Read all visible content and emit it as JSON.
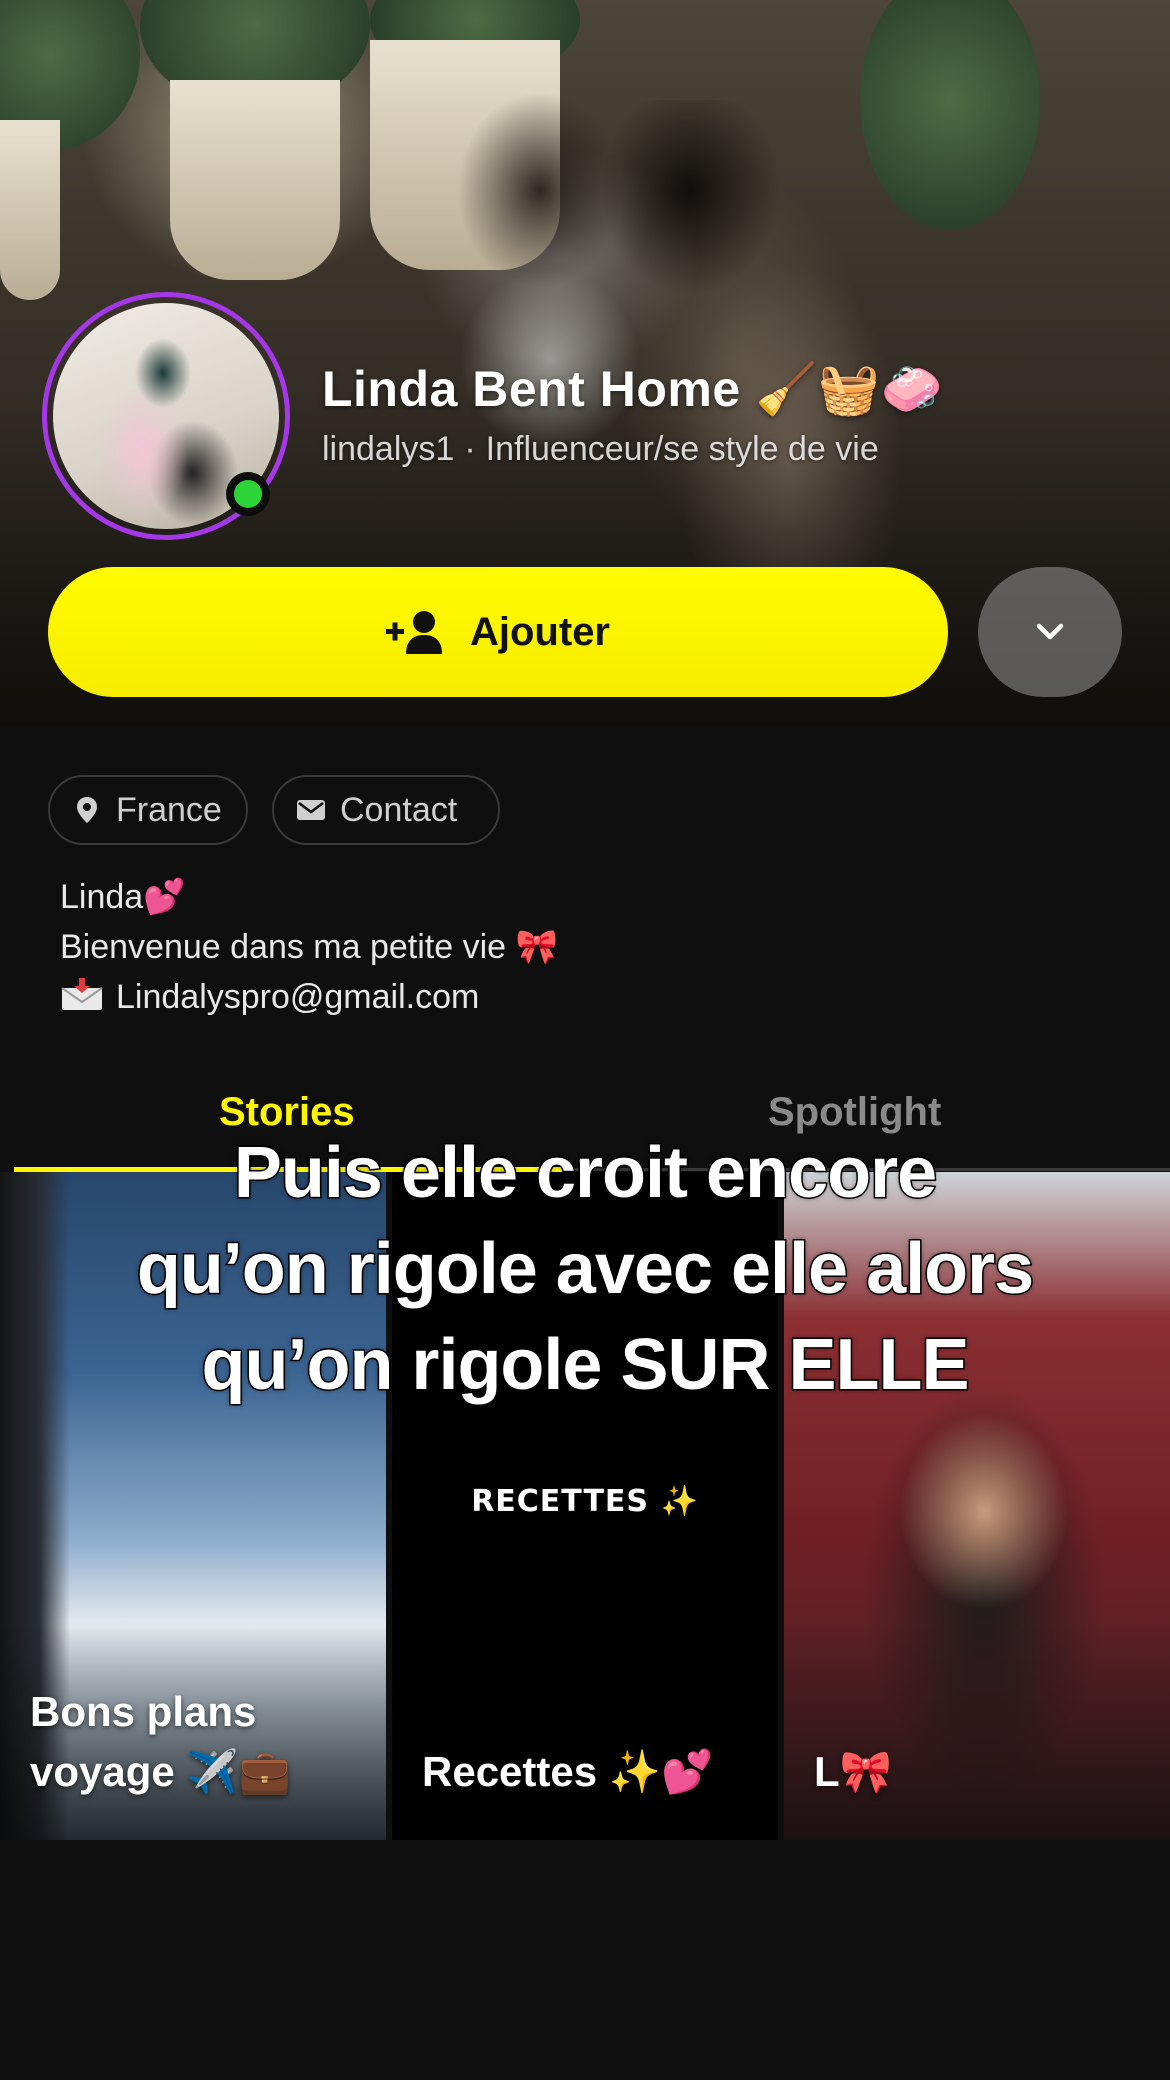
{
  "profile": {
    "display_name": "Linda Bent Home 🧹🧺🧼",
    "username": "lindalys1",
    "separator": "·",
    "category": "Influenceur/se style de vie",
    "online": true
  },
  "actions": {
    "add_label": "Ajouter",
    "add_icon": "add-friend-icon",
    "more_icon": "chevron-down-icon",
    "accent_color": "#fffc00"
  },
  "chips": {
    "country": "France",
    "contact": "Contact"
  },
  "bio": {
    "line1": "Linda💕",
    "line2": "Bienvenue dans ma petite vie 🎀",
    "email": "Lindalyspro@gmail.com"
  },
  "tabs": {
    "stories": "Stories",
    "spotlight": "Spotlight",
    "active": "stories"
  },
  "stories": [
    {
      "label_line1": "Bons plans",
      "label_line2": "voyage ✈️💼"
    },
    {
      "label_line1": "Recettes ✨💕",
      "sign": "RECETTES ✨"
    },
    {
      "label_line1": "L🎀"
    }
  ],
  "caption": {
    "line1": "Puis elle croit encore",
    "line2": "qu’on rigole avec elle alors",
    "line3": "qu’on rigole SUR ELLE"
  }
}
